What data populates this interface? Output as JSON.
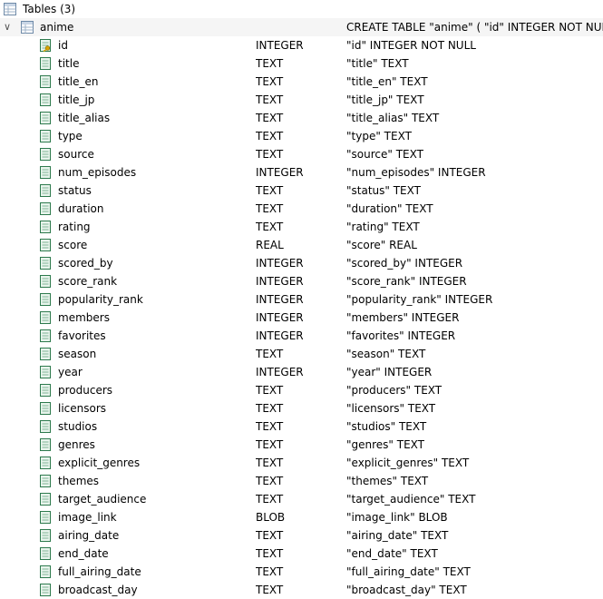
{
  "tree": {
    "root_label": "Tables (3)",
    "table": {
      "name": "anime",
      "schema": "CREATE TABLE \"anime\" ( \"id\" INTEGER NOT NULL"
    },
    "fields": [
      {
        "name": "id",
        "type": "INTEGER",
        "schema": "\"id\" INTEGER NOT NULL",
        "icon": "key-field-icon"
      },
      {
        "name": "title",
        "type": "TEXT",
        "schema": "\"title\" TEXT",
        "icon": "field-icon"
      },
      {
        "name": "title_en",
        "type": "TEXT",
        "schema": "\"title_en\" TEXT",
        "icon": "field-icon"
      },
      {
        "name": "title_jp",
        "type": "TEXT",
        "schema": "\"title_jp\" TEXT",
        "icon": "field-icon"
      },
      {
        "name": "title_alias",
        "type": "TEXT",
        "schema": "\"title_alias\" TEXT",
        "icon": "field-icon"
      },
      {
        "name": "type",
        "type": "TEXT",
        "schema": "\"type\" TEXT",
        "icon": "field-icon"
      },
      {
        "name": "source",
        "type": "TEXT",
        "schema": "\"source\" TEXT",
        "icon": "field-icon"
      },
      {
        "name": "num_episodes",
        "type": "INTEGER",
        "schema": "\"num_episodes\" INTEGER",
        "icon": "field-icon"
      },
      {
        "name": "status",
        "type": "TEXT",
        "schema": "\"status\" TEXT",
        "icon": "field-icon"
      },
      {
        "name": "duration",
        "type": "TEXT",
        "schema": "\"duration\" TEXT",
        "icon": "field-icon"
      },
      {
        "name": "rating",
        "type": "TEXT",
        "schema": "\"rating\" TEXT",
        "icon": "field-icon"
      },
      {
        "name": "score",
        "type": "REAL",
        "schema": "\"score\" REAL",
        "icon": "field-icon"
      },
      {
        "name": "scored_by",
        "type": "INTEGER",
        "schema": "\"scored_by\" INTEGER",
        "icon": "field-icon"
      },
      {
        "name": "score_rank",
        "type": "INTEGER",
        "schema": "\"score_rank\" INTEGER",
        "icon": "field-icon"
      },
      {
        "name": "popularity_rank",
        "type": "INTEGER",
        "schema": "\"popularity_rank\" INTEGER",
        "icon": "field-icon"
      },
      {
        "name": "members",
        "type": "INTEGER",
        "schema": "\"members\" INTEGER",
        "icon": "field-icon"
      },
      {
        "name": "favorites",
        "type": "INTEGER",
        "schema": "\"favorites\" INTEGER",
        "icon": "field-icon"
      },
      {
        "name": "season",
        "type": "TEXT",
        "schema": "\"season\" TEXT",
        "icon": "field-icon"
      },
      {
        "name": "year",
        "type": "INTEGER",
        "schema": "\"year\" INTEGER",
        "icon": "field-icon"
      },
      {
        "name": "producers",
        "type": "TEXT",
        "schema": "\"producers\" TEXT",
        "icon": "field-icon"
      },
      {
        "name": "licensors",
        "type": "TEXT",
        "schema": "\"licensors\" TEXT",
        "icon": "field-icon"
      },
      {
        "name": "studios",
        "type": "TEXT",
        "schema": "\"studios\" TEXT",
        "icon": "field-icon"
      },
      {
        "name": "genres",
        "type": "TEXT",
        "schema": "\"genres\" TEXT",
        "icon": "field-icon"
      },
      {
        "name": "explicit_genres",
        "type": "TEXT",
        "schema": "\"explicit_genres\" TEXT",
        "icon": "field-icon"
      },
      {
        "name": "themes",
        "type": "TEXT",
        "schema": "\"themes\" TEXT",
        "icon": "field-icon"
      },
      {
        "name": "target_audience",
        "type": "TEXT",
        "schema": "\"target_audience\" TEXT",
        "icon": "field-icon"
      },
      {
        "name": "image_link",
        "type": "BLOB",
        "schema": "\"image_link\" BLOB",
        "icon": "field-icon"
      },
      {
        "name": "airing_date",
        "type": "TEXT",
        "schema": "\"airing_date\" TEXT",
        "icon": "field-icon"
      },
      {
        "name": "end_date",
        "type": "TEXT",
        "schema": "\"end_date\" TEXT",
        "icon": "field-icon"
      },
      {
        "name": "full_airing_date",
        "type": "TEXT",
        "schema": "\"full_airing_date\" TEXT",
        "icon": "field-icon"
      },
      {
        "name": "broadcast_day",
        "type": "TEXT",
        "schema": "\"broadcast_day\" TEXT",
        "icon": "field-icon"
      }
    ]
  },
  "colors": {
    "field_icon_border": "#2d7a4d",
    "field_icon_fill": "#e8f4ec",
    "key_icon": "#d9a400",
    "table_icon_border": "#6e8aa8"
  }
}
